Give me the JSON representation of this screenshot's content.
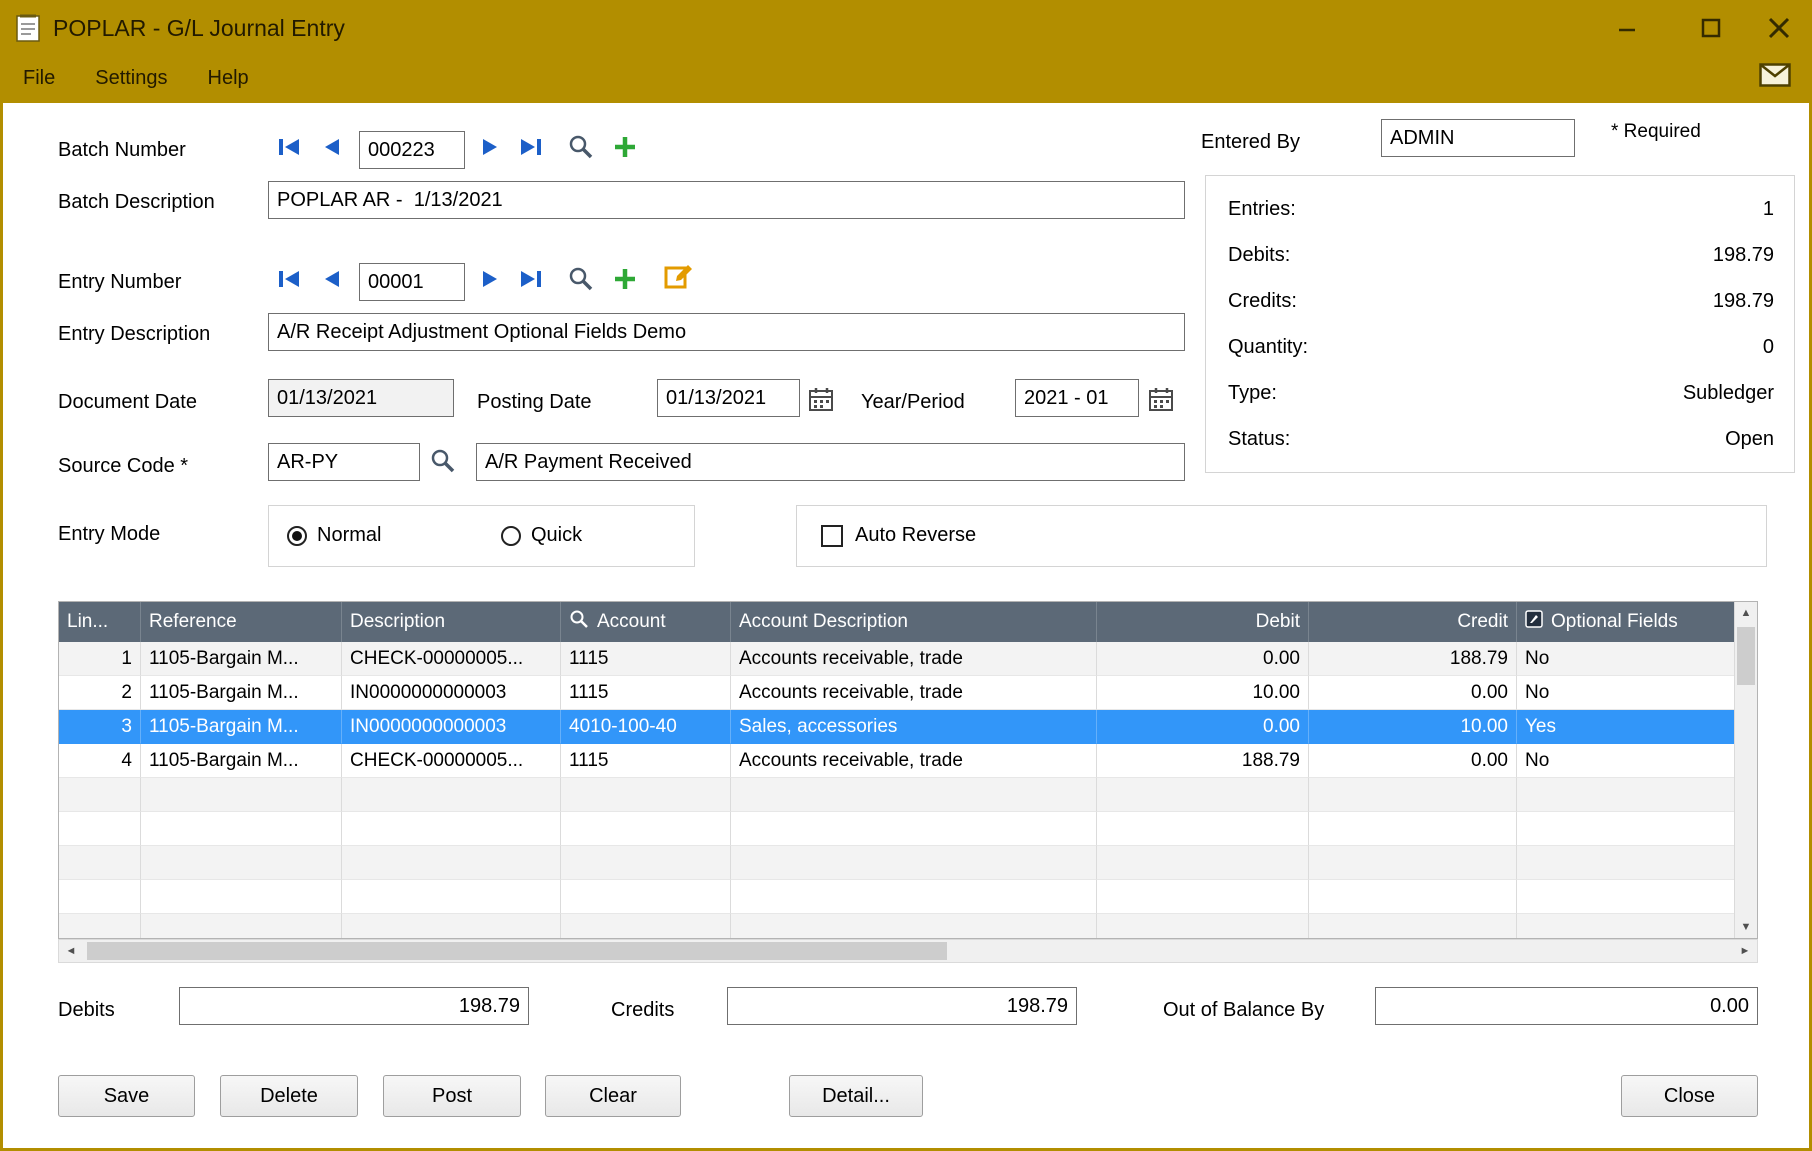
{
  "colors": {
    "titlebar": "#B28E00",
    "grid_header": "#5C6977",
    "selection": "#3296F9",
    "nav_blue": "#1C5FC8",
    "plus_green": "#2EA836",
    "note_orange": "#E39B00"
  },
  "window": {
    "title": "POPLAR - G/L Journal Entry",
    "menus": [
      "File",
      "Settings",
      "Help"
    ]
  },
  "form": {
    "batch_number_label": "Batch Number",
    "batch_number": "000223",
    "batch_description_label": "Batch Description",
    "batch_description": "POPLAR AR -  1/13/2021",
    "entered_by_label": "Entered By",
    "entered_by": "ADMIN",
    "required_note": "* Required",
    "entry_number_label": "Entry Number",
    "entry_number": "00001",
    "entry_description_label": "Entry Description",
    "entry_description": "A/R Receipt Adjustment Optional Fields Demo",
    "document_date_label": "Document Date",
    "document_date": "01/13/2021",
    "posting_date_label": "Posting Date",
    "posting_date": "01/13/2021",
    "year_period_label": "Year/Period",
    "year_period": "2021 - 01",
    "source_code_label": "Source Code *",
    "source_code": "AR-PY",
    "source_code_description": "A/R Payment Received",
    "entry_mode_label": "Entry Mode",
    "entry_mode_normal": "Normal",
    "entry_mode_quick": "Quick",
    "auto_reverse_label": "Auto Reverse"
  },
  "summary": {
    "rows": [
      {
        "label": "Entries:",
        "value": "1"
      },
      {
        "label": "Debits:",
        "value": "198.79"
      },
      {
        "label": "Credits:",
        "value": "198.79"
      },
      {
        "label": "Quantity:",
        "value": "0"
      },
      {
        "label": "Type:",
        "value": "Subledger"
      },
      {
        "label": "Status:",
        "value": "Open"
      }
    ]
  },
  "grid": {
    "columns": {
      "line": "Lin...",
      "reference": "Reference",
      "description": "Description",
      "account": "Account",
      "account_description": "Account Description",
      "debit": "Debit",
      "credit": "Credit",
      "optional_fields": "Optional Fields"
    },
    "rows": [
      {
        "line": "1",
        "reference": "1105-Bargain M...",
        "description": "CHECK-00000005...",
        "account": "1115",
        "account_description": "Accounts receivable, trade",
        "debit": "0.00",
        "credit": "188.79",
        "optional_fields": "No",
        "selected": false
      },
      {
        "line": "2",
        "reference": "1105-Bargain M...",
        "description": "IN0000000000003",
        "account": "1115",
        "account_description": "Accounts receivable, trade",
        "debit": "10.00",
        "credit": "0.00",
        "optional_fields": "No",
        "selected": false
      },
      {
        "line": "3",
        "reference": "1105-Bargain M...",
        "description": "IN0000000000003",
        "account": "4010-100-40",
        "account_description": "Sales, accessories",
        "debit": "0.00",
        "credit": "10.00",
        "optional_fields": "Yes",
        "selected": true
      },
      {
        "line": "4",
        "reference": "1105-Bargain M...",
        "description": "CHECK-00000005...",
        "account": "1115",
        "account_description": "Accounts receivable, trade",
        "debit": "188.79",
        "credit": "0.00",
        "optional_fields": "No",
        "selected": false
      }
    ],
    "empty_rows": 5
  },
  "totals": {
    "debits_label": "Debits",
    "debits": "198.79",
    "credits_label": "Credits",
    "credits": "198.79",
    "out_of_balance_label": "Out of Balance By",
    "out_of_balance": "0.00"
  },
  "buttons": {
    "save": "Save",
    "delete": "Delete",
    "post": "Post",
    "clear": "Clear",
    "detail": "Detail...",
    "close": "Close"
  }
}
